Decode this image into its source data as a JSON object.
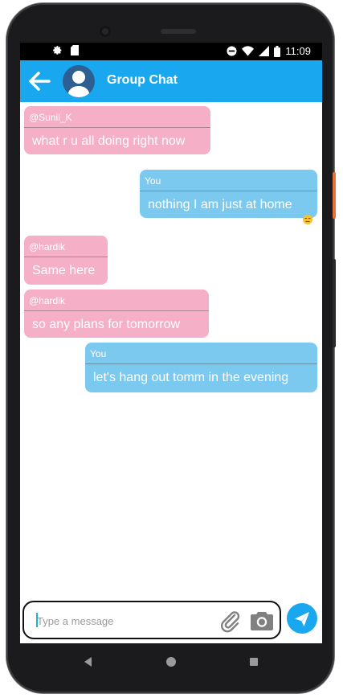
{
  "status_bar": {
    "time": "11:09",
    "icons": [
      "gear-icon",
      "sd-card-icon",
      "do-not-disturb-icon",
      "wifi-icon",
      "signal-icon",
      "battery-icon"
    ]
  },
  "header": {
    "title": "Group Chat",
    "back_icon": "arrow-left-icon",
    "avatar_icon": "person-avatar-icon"
  },
  "messages": [
    {
      "direction": "received",
      "sender": "@Sunil_K",
      "text": "what r u all doing right now"
    },
    {
      "direction": "sent",
      "sender": "You",
      "text": "nothing I am just at home",
      "emoji": "unamused-face-emoji"
    },
    {
      "direction": "received",
      "sender": "@hardik",
      "text": "Same here"
    },
    {
      "direction": "received",
      "sender": "@hardik",
      "text": "so any plans for tomorrow"
    },
    {
      "direction": "sent",
      "sender": "You",
      "text": "let's hang out tomm in the evening"
    }
  ],
  "composer": {
    "placeholder": "Type a message",
    "value": ""
  },
  "colors": {
    "app_bar": "#19a8f0",
    "received_bubble": "#f5afc7",
    "sent_bubble": "#7cc9f0",
    "send_button": "#19a8f0"
  }
}
